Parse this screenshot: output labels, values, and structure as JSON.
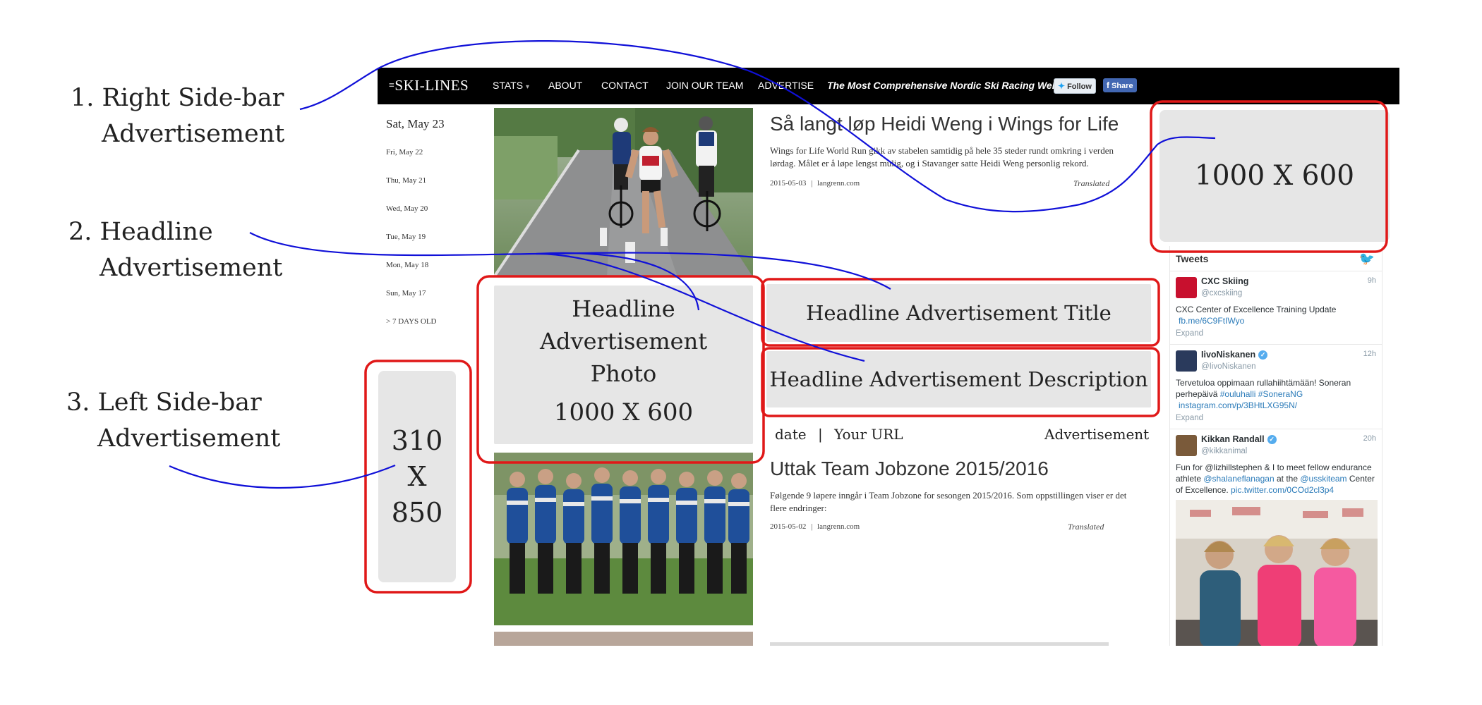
{
  "annotations": {
    "right_sidebar_ad": {
      "line1": "1. Right Side-bar",
      "line2": "Advertisement"
    },
    "headline_ad": {
      "line1": "2. Headline",
      "line2": "Advertisement"
    },
    "left_sidebar_ad": {
      "line1": "3. Left Side-bar",
      "line2": "Advertisement"
    }
  },
  "site": {
    "logo": "SKI-LINES",
    "nav": [
      "STATS",
      "ABOUT",
      "CONTACT",
      "JOIN OUR TEAM",
      "ADVERTISE"
    ],
    "stats_caret": "▾",
    "tagline": "The Most Comprehensive Nordic Ski Racing Website!",
    "follow_label": "Follow",
    "share_label": "Share"
  },
  "dates": {
    "current": "Sat, May 23",
    "items": [
      "Fri, May 22",
      "Thu, May 21",
      "Wed, May 20",
      "Tue, May 19",
      "Mon, May 18",
      "Sun, May 17",
      "> 7 DAYS OLD"
    ]
  },
  "articles": [
    {
      "title": "Så langt løp Heidi Weng i Wings for Life",
      "description": "Wings for Life World Run gikk av stabelen samtidig på hele 35 steder rundt omkring i verden lørdag. Målet er å løpe lengst mulig, og i Stavanger satte Heidi Weng personlig rekord.",
      "date": "2015-05-03",
      "source": "langrenn.com",
      "translated": "Translated"
    },
    {
      "title": "Uttak Team Jobzone 2015/2016",
      "description": "Følgende 9 løpere inngår i Team Jobzone for sesongen 2015/2016. Som oppstillingen viser er det flere endringer:",
      "date": "2015-05-02",
      "source": "langrenn.com",
      "translated": "Translated"
    }
  ],
  "meta_separator": "|",
  "headline_ad": {
    "photo_lines": [
      "Headline",
      "Advertisement",
      "Photo"
    ],
    "photo_size": "1000 X 600",
    "title": "Headline Advertisement Title",
    "description": "Headline Advertisement Description",
    "date": "date",
    "url": "Your URL",
    "label": "Advertisement"
  },
  "right_ad": {
    "size": "1000 X 600"
  },
  "left_ad": {
    "lines": [
      "310",
      "X",
      "850"
    ]
  },
  "tweets": {
    "header": "Tweets",
    "items": [
      {
        "name": "CXC Skiing",
        "handle": "@cxcskiing",
        "time": "9h",
        "text": "CXC Center of Excellence Training Update",
        "link": "fb.me/6C9FtIWyo",
        "expand": "Expand",
        "avatar_color": "#c8102e"
      },
      {
        "name": "IivoNiskanen",
        "handle": "@IivoNiskanen",
        "time": "12h",
        "text_a": "Tervetuloa oppimaan rullahiihtämään! Soneran perhepäivä ",
        "hashtag1": "#ouluhalli",
        "hashtag2": "#SoneraNG",
        "link": "instagram.com/p/3BHtLXG95N/",
        "expand": "Expand",
        "avatar_color": "#2a3a5c"
      },
      {
        "name": "Kikkan Randall",
        "handle": "@kikkanimal",
        "time": "20h",
        "text_a": "Fun for @lizhillstephen & I to meet fellow endurance athlete ",
        "mention": "@shalaneflanagan",
        "text_b": " at the ",
        "mention2": "@usskiteam",
        "text_c": " Center of Excellence. ",
        "link": "pic.twitter.com/0COd2cl3p4",
        "avatar_color": "#7a5a3a"
      }
    ]
  },
  "colors": {
    "annotation_frame": "#e01818",
    "annotation_line": "#1010d8",
    "nav_background": "#000000",
    "ad_placeholder": "#e6e6e6",
    "twitter_blue": "#1da1f2"
  }
}
